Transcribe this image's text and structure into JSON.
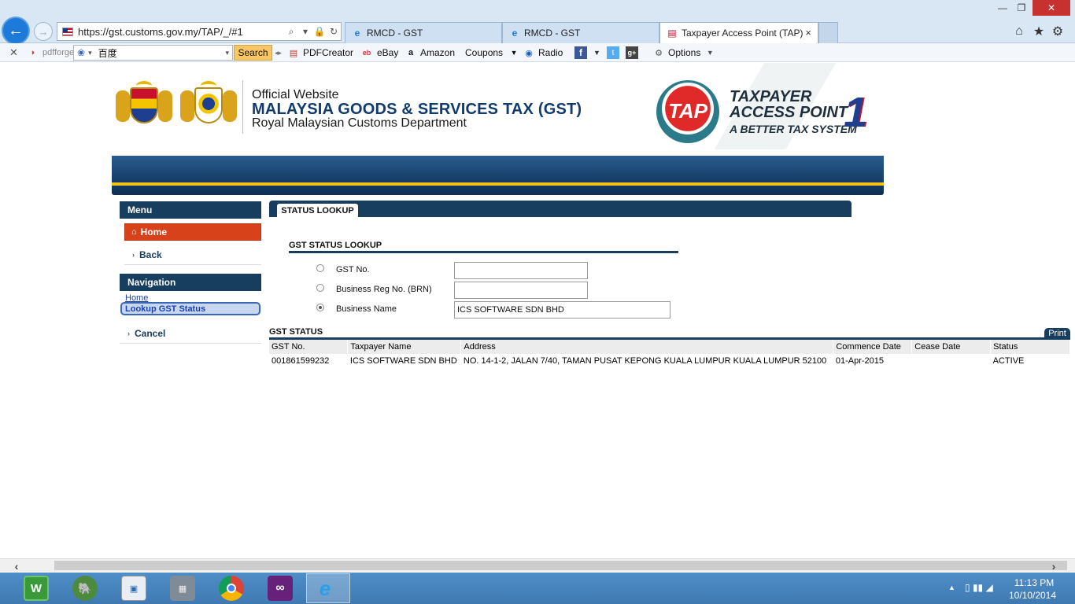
{
  "browser": {
    "url": "https://gst.customs.gov.my/TAP/_/#1",
    "tabs": [
      {
        "title": "RMCD - GST"
      },
      {
        "title": "RMCD - GST"
      },
      {
        "title": "Taxpayer Access Point (TAP)"
      }
    ],
    "close_glyph": "×",
    "window": {
      "minimize": "—",
      "maximize": "❐",
      "close": "✕"
    }
  },
  "toolbar": {
    "close": "✕",
    "pdfforge": "pdfforge",
    "search_value": "百度",
    "search_button": "Search",
    "pdfcreator": "PDFCreator",
    "ebay": "eBay",
    "amazon": "Amazon",
    "coupons": "Coupons",
    "radio": "Radio",
    "options": "Options"
  },
  "header": {
    "official": "Official Website",
    "title": "MALAYSIA GOODS & SERVICES TAX (GST)",
    "department": "Royal Malaysian Customs Department",
    "tap_logo": "TAP",
    "tap_line1": "TAXPAYER",
    "tap_line2": "ACCESS POINT",
    "tap_slogan": "A BETTER TAX SYSTEM",
    "logo_number": "1"
  },
  "menu": {
    "heading": "Menu",
    "home": "Home",
    "back": "Back",
    "cancel": "Cancel"
  },
  "navigation": {
    "heading": "Navigation",
    "home": "Home",
    "lookup": "Lookup GST Status"
  },
  "main": {
    "tab_label": "STATUS LOOKUP",
    "lookup_title": "GST STATUS LOOKUP",
    "fields": {
      "gst_no_label": "GST No.",
      "gst_no_value": "",
      "brn_label": "Business Reg No. (BRN)",
      "brn_value": "",
      "name_label": "Business Name",
      "name_value": "ICS SOFTWARE SDN BHD"
    },
    "selected_option": "Business Name",
    "status_title": "GST STATUS",
    "print": "Print",
    "table": {
      "headers": [
        "GST No.",
        "Taxpayer Name",
        "Address",
        "Commence Date",
        "Cease Date",
        "Status"
      ],
      "rows": [
        [
          "001861599232",
          "ICS SOFTWARE SDN BHD",
          "NO. 14-1-2, JALAN 7/40, TAMAN PUSAT KEPONG KUALA LUMPUR KUALA LUMPUR 52100",
          "01-Apr-2015",
          "",
          "ACTIVE"
        ]
      ]
    }
  },
  "taskbar": {
    "time": "11:13 PM",
    "date": "10/10/2014"
  },
  "colors": {
    "navy": "#173d5f",
    "home_orange": "#d8421a",
    "banner_gold": "#f2c21a"
  }
}
